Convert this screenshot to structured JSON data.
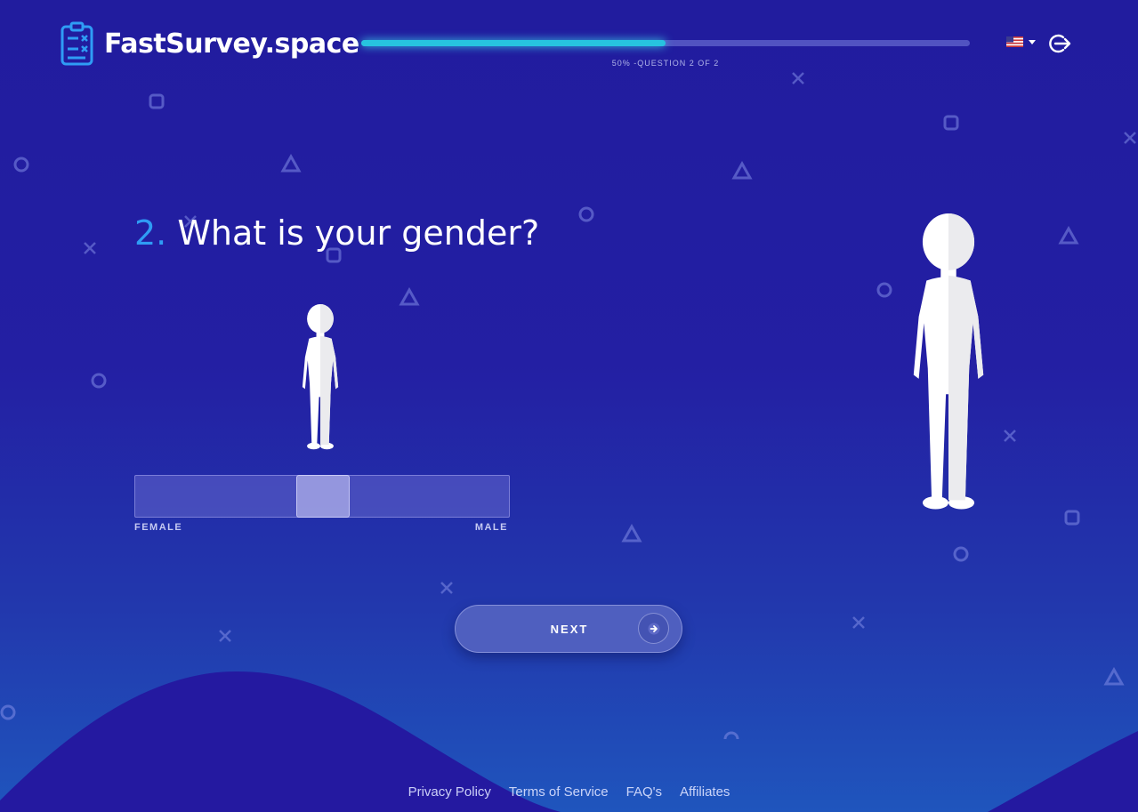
{
  "app": {
    "logo_text": "FastSurvey.space"
  },
  "progress": {
    "percent": 50,
    "label": "50% -QUESTION 2 OF 2"
  },
  "header": {
    "language_flag": "us-flag-icon",
    "logout_icon": "logout-icon"
  },
  "question": {
    "number": "2.",
    "text": "What is your gender?"
  },
  "slider": {
    "left_label": "FEMALE",
    "right_label": "MALE",
    "value": 0.5
  },
  "next_button": {
    "label": "NEXT"
  },
  "footer": {
    "links": [
      "Privacy Policy",
      "Terms of Service",
      "FAQ's",
      "Affiliates"
    ]
  },
  "colors": {
    "accent": "#2f9cf5",
    "progress": "#27c3df",
    "background": "#221da0"
  }
}
